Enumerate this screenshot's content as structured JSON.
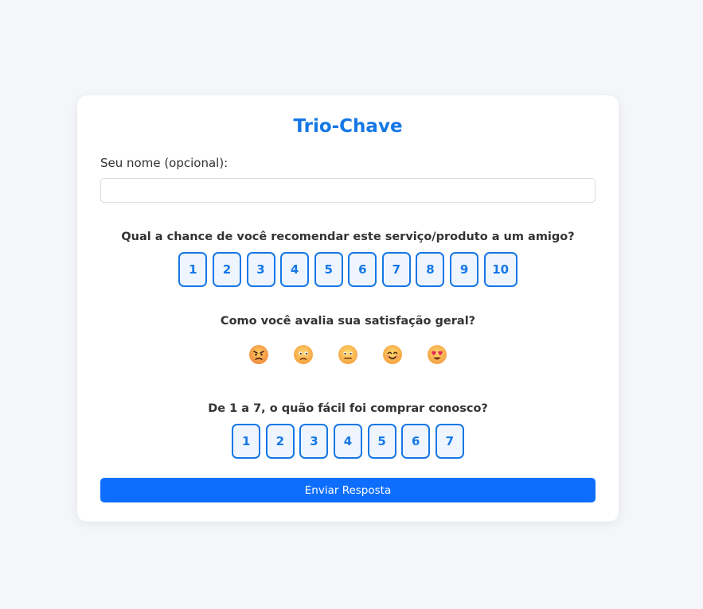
{
  "form": {
    "title": "Trio-Chave",
    "name_label": "Seu nome (opcional):",
    "name_value": "",
    "name_placeholder": ""
  },
  "nps": {
    "question": "Qual a chance de você recomendar este serviço/produto a um amigo?",
    "options": [
      "1",
      "2",
      "3",
      "4",
      "5",
      "6",
      "7",
      "8",
      "9",
      "10"
    ]
  },
  "satisfaction": {
    "question": "Como você avalia sua satisfação geral?",
    "options": [
      {
        "icon": "angry-face-icon"
      },
      {
        "icon": "worried-face-icon"
      },
      {
        "icon": "neutral-face-icon"
      },
      {
        "icon": "smiling-face-icon"
      },
      {
        "icon": "heart-eyes-face-icon"
      }
    ]
  },
  "ease": {
    "question": "De 1 a 7, o quão fácil foi comprar conosco?",
    "options": [
      "1",
      "2",
      "3",
      "4",
      "5",
      "6",
      "7"
    ]
  },
  "submit_label": "Enviar Resposta",
  "colors": {
    "accent": "#1577e6",
    "button": "#0d6efd",
    "background": "#f4f6fa"
  }
}
